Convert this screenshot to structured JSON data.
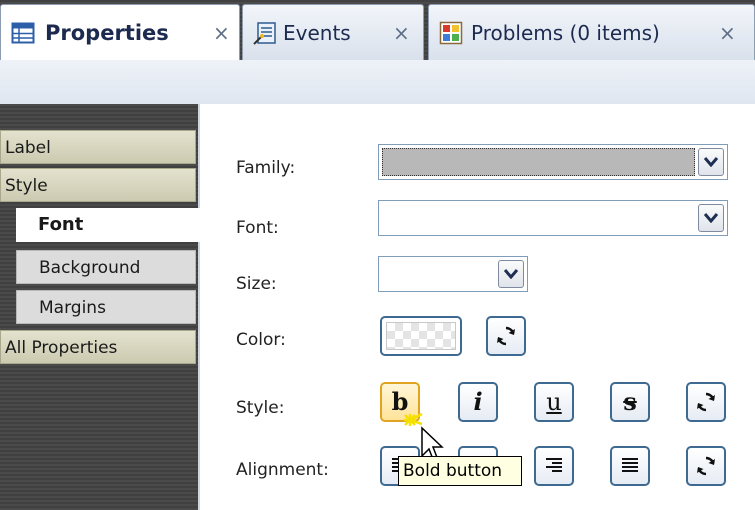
{
  "tabs": [
    {
      "label": "Properties",
      "close": "×",
      "icon": "table-icon",
      "active": true
    },
    {
      "label": "Events",
      "close": "×",
      "icon": "events-icon",
      "active": false
    },
    {
      "label": "Problems (0 items)",
      "close": "×",
      "icon": "problems-icon",
      "active": false
    }
  ],
  "nav": {
    "label": "Label",
    "style": "Style",
    "font": "Font",
    "background": "Background",
    "margins": "Margins",
    "all_properties": "All Properties"
  },
  "form": {
    "family_label": "Family:",
    "font_label": "Font:",
    "size_label": "Size:",
    "color_label": "Color:",
    "style_label": "Style:",
    "alignment_label": "Alignment:",
    "family_value": "",
    "font_value": "",
    "size_value": ""
  },
  "style_buttons": {
    "bold": "b",
    "italic": "i",
    "underline": "u",
    "strike": "s"
  },
  "tooltip": "Bold button",
  "colors": {
    "accent_border": "#3e6a92",
    "hot_border": "#e0a420",
    "nav_category": "#cccab0",
    "tooltip_bg": "#ffffe1"
  }
}
